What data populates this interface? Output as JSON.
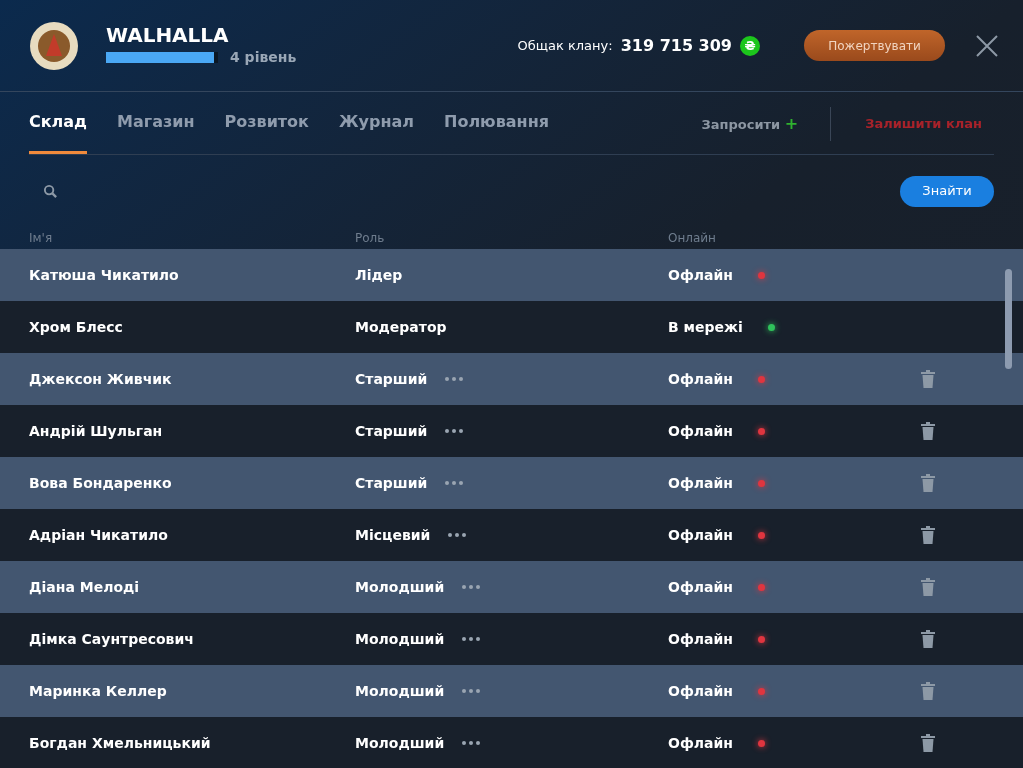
{
  "clan": {
    "name": "WALHALLA",
    "level": 0.96,
    "level_label": "4 рівень"
  },
  "treasury": {
    "label": "Общак клану:",
    "amount": "319 715 309",
    "currency": "₴"
  },
  "donate_button": "Пожертвувати",
  "tabs": [
    {
      "label": "Склад",
      "selected": true
    },
    {
      "label": "Магазин",
      "selected": false
    },
    {
      "label": "Розвиток",
      "selected": false
    },
    {
      "label": "Журнал",
      "selected": false
    },
    {
      "label": "Полювання",
      "selected": false
    }
  ],
  "invite": {
    "label": "Запросити",
    "icon": "+"
  },
  "leave": "Залишити клан",
  "search_button": "Знайти",
  "table": {
    "columns": [
      "Ім'я",
      "Роль",
      "Онлайн"
    ],
    "rows": [
      {
        "name": "Катюша Чикатило",
        "role": "Лідер",
        "status": "Офлайн",
        "online": false,
        "menu": false,
        "removable": false
      },
      {
        "name": "Хром Блесс",
        "role": "Модератор",
        "status": "В мережі",
        "online": true,
        "menu": false,
        "removable": false
      },
      {
        "name": "Джексон Живчик",
        "role": "Старший",
        "status": "Офлайн",
        "online": false,
        "menu": true,
        "removable": true
      },
      {
        "name": "Андрій Шульган",
        "role": "Старший",
        "status": "Офлайн",
        "online": false,
        "menu": true,
        "removable": true
      },
      {
        "name": "Вова Бондаренко",
        "role": "Старший",
        "status": "Офлайн",
        "online": false,
        "menu": true,
        "removable": true
      },
      {
        "name": "Адріан Чикатило",
        "role": "Місцевий",
        "status": "Офлайн",
        "online": false,
        "menu": true,
        "removable": true
      },
      {
        "name": "Діана Мелоді",
        "role": "Молодший",
        "status": "Офлайн",
        "online": false,
        "menu": true,
        "removable": true
      },
      {
        "name": "Дімка Саунтресович",
        "role": "Молодший",
        "status": "Офлайн",
        "online": false,
        "menu": true,
        "removable": true
      },
      {
        "name": "Маринка Келлер",
        "role": "Молодший",
        "status": "Офлайн",
        "online": false,
        "menu": true,
        "removable": true
      },
      {
        "name": "Богдан Хмельницький",
        "role": "Молодший",
        "status": "Офлайн",
        "online": false,
        "menu": true,
        "removable": true
      }
    ]
  }
}
